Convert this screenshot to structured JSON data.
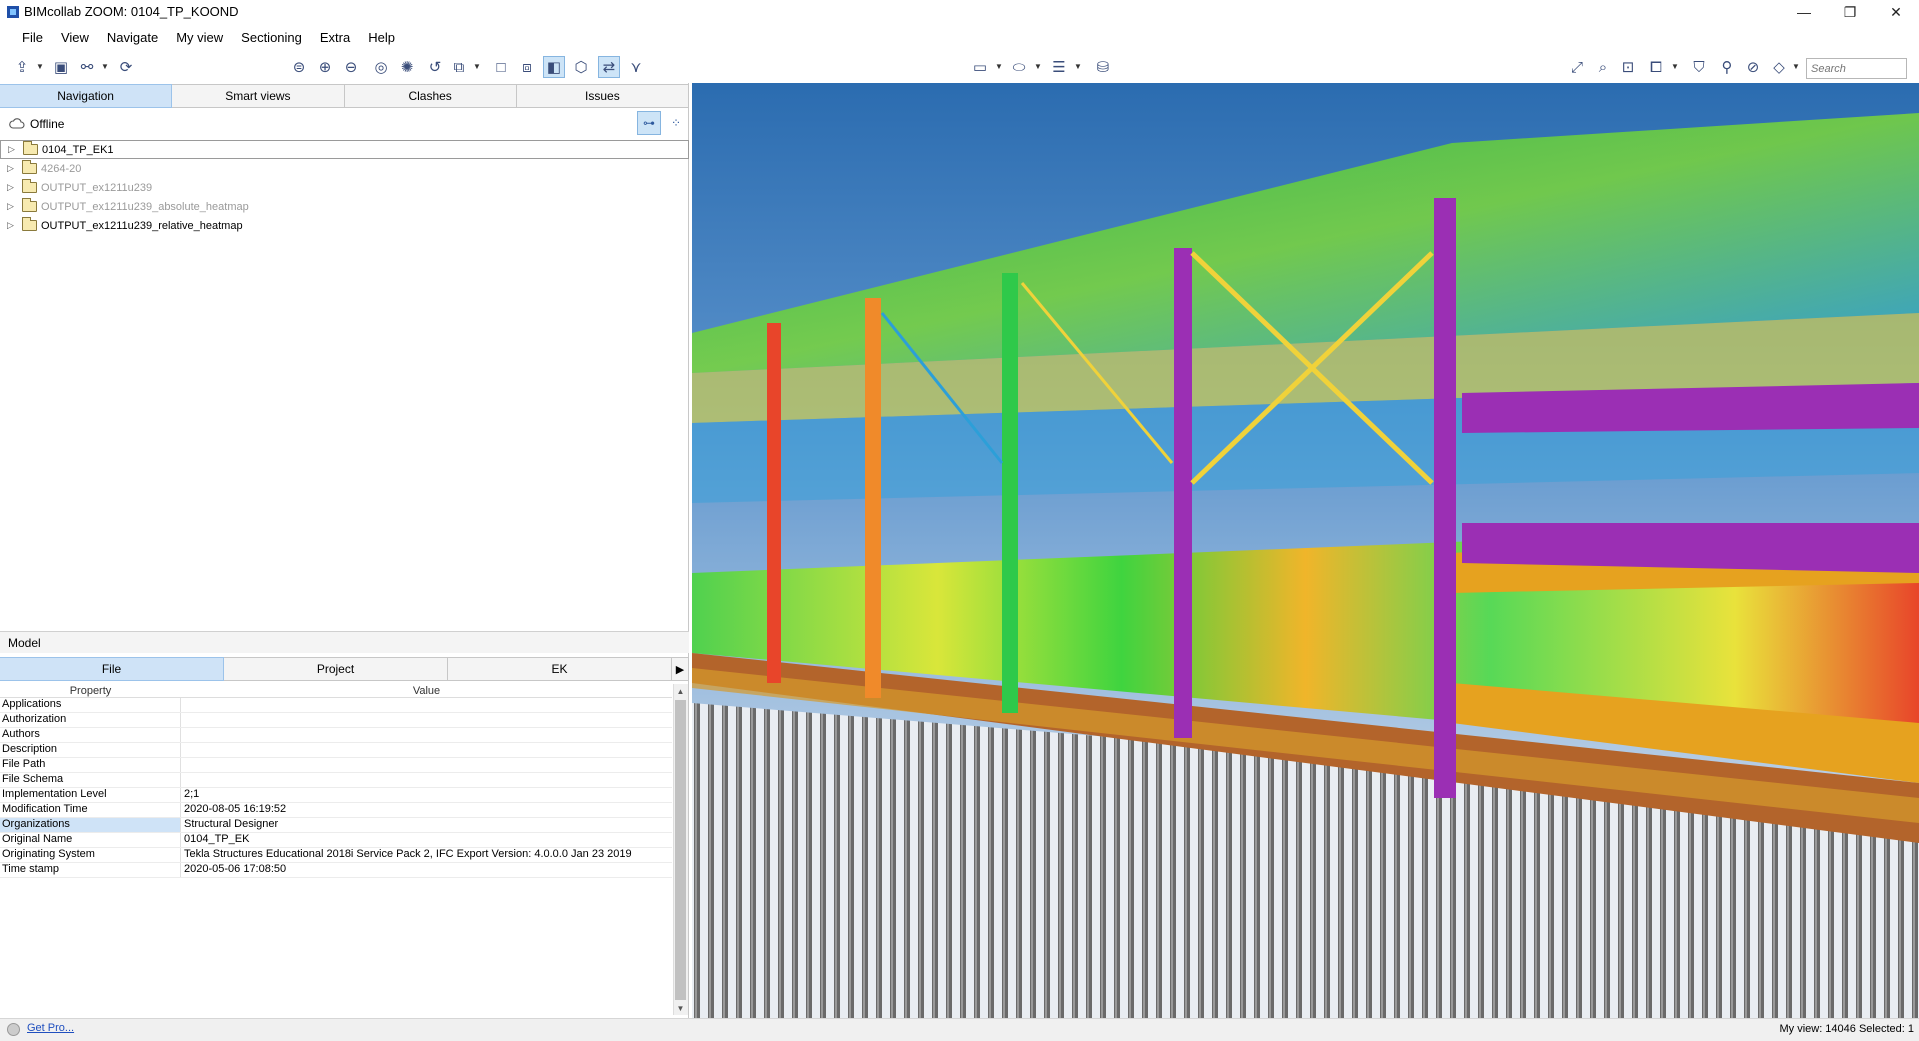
{
  "window": {
    "title": "BIMcollab ZOOM: 0104_TP_KOOND",
    "controls": {
      "minimize": "—",
      "restore": "❐",
      "close": "✕"
    }
  },
  "menu": [
    "File",
    "View",
    "Navigate",
    "My view",
    "Sectioning",
    "Extra",
    "Help"
  ],
  "toolbar": {
    "search_placeholder": "Search"
  },
  "top_tabs": [
    "Navigation",
    "Smart views",
    "Clashes",
    "Issues"
  ],
  "selected_top_tab": "Navigation",
  "connection_status": "Offline",
  "tree": [
    {
      "label": "0104_TP_EK1",
      "dim": false,
      "selected": true
    },
    {
      "label": "4264-20",
      "dim": true,
      "selected": false
    },
    {
      "label": "OUTPUT_ex1211u239",
      "dim": true,
      "selected": false
    },
    {
      "label": "OUTPUT_ex1211u239_absolute_heatmap",
      "dim": true,
      "selected": false
    },
    {
      "label": "OUTPUT_ex1211u239_relative_heatmap",
      "dim": false,
      "selected": false
    }
  ],
  "model_panel": {
    "title": "Model",
    "tabs": [
      "File",
      "Project",
      "EK"
    ],
    "selected_tab": "File",
    "next_arrow": "▶",
    "columns": {
      "property": "Property",
      "value": "Value"
    },
    "rows": [
      {
        "k": "Applications",
        "v": ""
      },
      {
        "k": "Authorization",
        "v": ""
      },
      {
        "k": "Authors",
        "v": ""
      },
      {
        "k": "Description",
        "v": ""
      },
      {
        "k": "File Path",
        "v": ""
      },
      {
        "k": "File Schema",
        "v": ""
      },
      {
        "k": "Implementation Level",
        "v": "2;1"
      },
      {
        "k": "Modification Time",
        "v": "2020-08-05 16:19:52"
      },
      {
        "k": "Organizations",
        "v": "Structural Designer"
      },
      {
        "k": "Original Name",
        "v": "0104_TP_EK"
      },
      {
        "k": "Originating System",
        "v": "Tekla Structures Educational 2018i Service Pack 2, IFC Export Version: 4.0.0.0 Jan 23 2019"
      },
      {
        "k": "Time stamp",
        "v": "2020-05-06 17:08:50"
      }
    ],
    "selected_row": "Organizations"
  },
  "status": {
    "get_pro": "Get Pro...",
    "my_view": "My view: 14046  Selected: 1"
  },
  "colors": {
    "tab_selected": "#cfe3f7",
    "sky_top": "#2b6cb0",
    "sky_bottom": "#dfe8f3",
    "wall": "#e6a21f",
    "purple_column": "#9b2fb4",
    "beam_brown": "#b3642b",
    "pile_gray": "#6a6a6a"
  }
}
